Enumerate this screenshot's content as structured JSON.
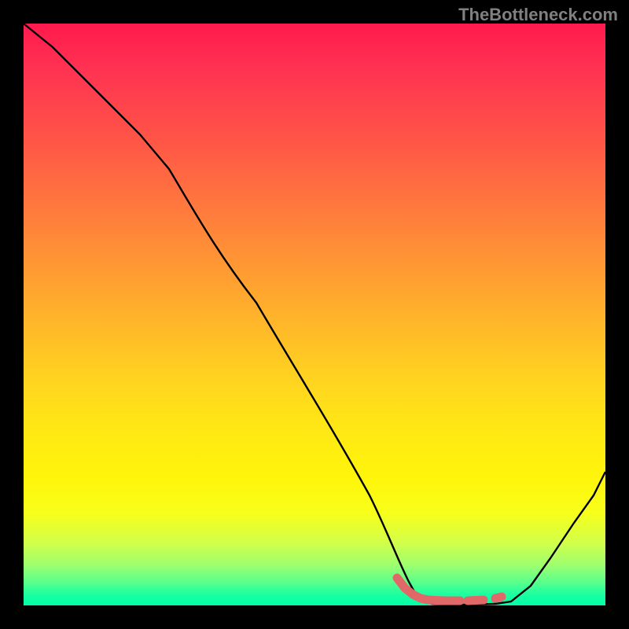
{
  "watermark": "TheBottleneck.com",
  "chart_data": {
    "type": "line",
    "title": "",
    "xlabel": "",
    "ylabel": "",
    "xlim": [
      0,
      100
    ],
    "ylim": [
      0,
      100
    ],
    "grid": false,
    "legend": false,
    "gradient_meaning": "vertical color gradient red→yellow→green, green at bottom indicating optimal (bottleneck curve)",
    "series": [
      {
        "name": "bottleneck-curve",
        "x": [
          0,
          5,
          10,
          15,
          20,
          25,
          30,
          35,
          40,
          45,
          50,
          55,
          60,
          63,
          66,
          68,
          72,
          76,
          80,
          84,
          88,
          92,
          96,
          100
        ],
        "y": [
          100,
          96,
          91,
          86,
          81,
          75,
          68,
          60,
          52,
          44,
          36,
          28,
          19,
          10,
          4,
          1,
          0,
          0,
          0,
          0,
          3,
          8,
          15,
          23
        ],
        "color": "#000000"
      }
    ],
    "minimum_markers": {
      "x_range": [
        63,
        80
      ],
      "color": "#e57373",
      "note": "thick salmon dashed segment highlighting the minimum region"
    }
  }
}
